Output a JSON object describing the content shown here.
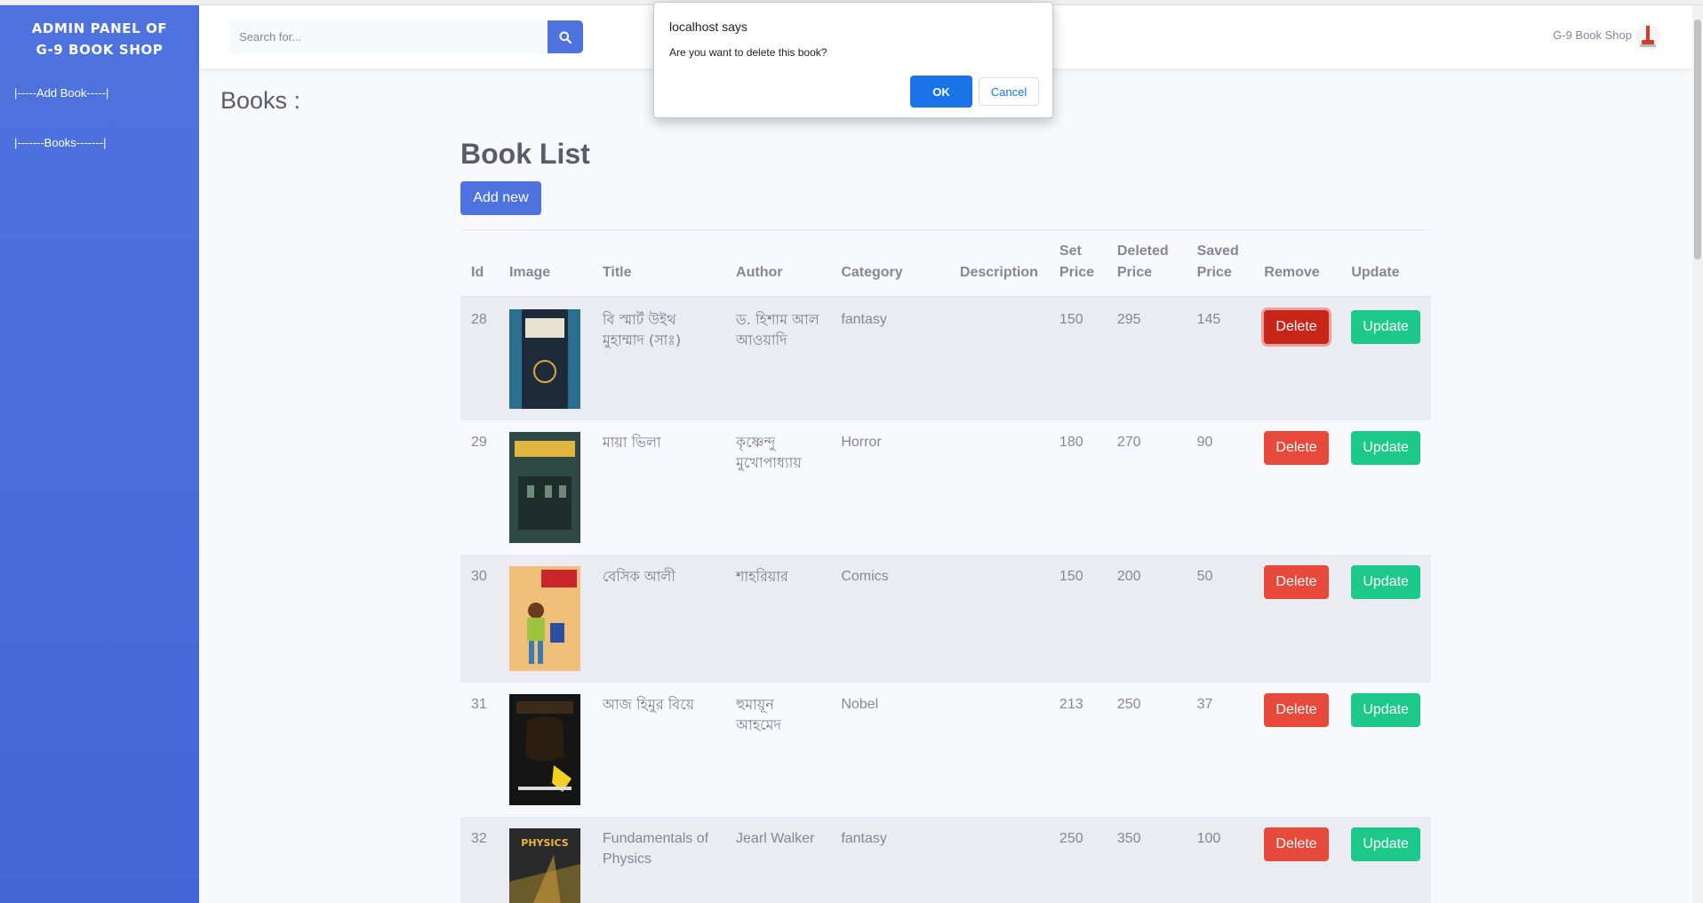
{
  "sidebar": {
    "brand_line1": "ADMIN PANEL OF",
    "brand_line2": "G-9 BOOK SHOP",
    "links": [
      "|-----Add Book-----|",
      "|-------Books-------|"
    ]
  },
  "topbar": {
    "search_placeholder": "Search for...",
    "shop_name": "G-9 Book Shop"
  },
  "main": {
    "heading": "Books :",
    "list_title": "Book List",
    "add_button": "Add new"
  },
  "table": {
    "headers": [
      "Id",
      "Image",
      "Title",
      "Author",
      "Category",
      "Description",
      "Set Price",
      "Deleted Price",
      "Saved Price",
      "Remove",
      "Update"
    ],
    "header_lines": {
      "set_price": [
        "Set",
        "Price"
      ],
      "deleted_price": [
        "Deleted",
        "Price"
      ],
      "saved_price": [
        "Saved",
        "Price"
      ]
    },
    "delete_label": "Delete",
    "update_label": "Update",
    "rows": [
      {
        "id": "28",
        "title": "বি স্মার্ট উইথ মুহাম্মাদ (সাঃ)",
        "author": "ড. হিশাম আল আওয়াদি",
        "category": "fantasy",
        "description": "",
        "set_price": "150",
        "deleted_price": "295",
        "saved_price": "145",
        "cover_color": "#1d2a3a"
      },
      {
        "id": "29",
        "title": "মায়া ভিলা",
        "author": "কৃষ্ণেন্দু মুখোপাধ্যায়",
        "category": "Horror",
        "description": "",
        "set_price": "180",
        "deleted_price": "270",
        "saved_price": "90",
        "cover_color": "#2f4a44"
      },
      {
        "id": "30",
        "title": "বেসিক আলী",
        "author": "শাহরিয়ার",
        "category": "Comics",
        "description": "",
        "set_price": "150",
        "deleted_price": "200",
        "saved_price": "50",
        "cover_color": "#f0c07a"
      },
      {
        "id": "31",
        "title": "আজ হিমুর বিয়ে",
        "author": "হুমায়ূন আহমেদ",
        "category": "Nobel",
        "description": "",
        "set_price": "213",
        "deleted_price": "250",
        "saved_price": "37",
        "cover_color": "#151515"
      },
      {
        "id": "32",
        "title": "Fundamentals of Physics",
        "author": "Jearl Walker",
        "category": "fantasy",
        "description": "",
        "set_price": "250",
        "deleted_price": "350",
        "saved_price": "100",
        "cover_color": "#2a2a2a"
      }
    ]
  },
  "dialog": {
    "title": "localhost says",
    "message": "Are you want to delete this book?",
    "ok": "OK",
    "cancel": "Cancel"
  },
  "colors": {
    "sidebar": "#4e73df",
    "primary": "#4e73df",
    "danger": "#e74a3b",
    "success": "#1cc88a",
    "dialog_ok": "#1a73e8"
  }
}
